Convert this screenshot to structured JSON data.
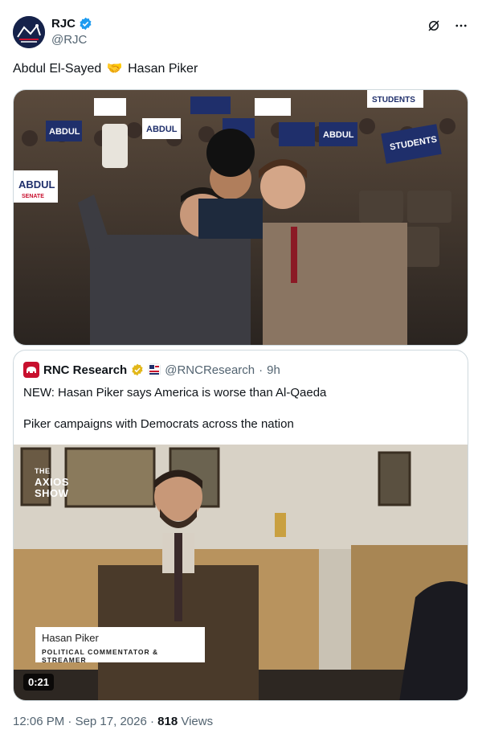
{
  "author": {
    "display_name": "RJC",
    "handle": "@RJC",
    "avatar_icon": "rjc-logo-icon",
    "verified_icon": "verified-badge-icon"
  },
  "actions": {
    "grok_icon": "grok-icon",
    "more_icon": "more-icon"
  },
  "tweet": {
    "text_before": "Abdul El-Sayed",
    "emoji": "🤝",
    "text_after": "Hasan Piker"
  },
  "media": {
    "signs": [
      "ABDUL",
      "STUDENTS",
      "ABDUL",
      "ABDUL",
      "ABDUL",
      "STUDENTS"
    ],
    "sign_sub": "SENATE",
    "sign_colors": {
      "navy": "#1f2f6b",
      "white": "#ffffff",
      "red": "#c8102e"
    }
  },
  "quote": {
    "display_name": "RNC Research",
    "handle": "@RNCResearch",
    "separator": "·",
    "time": "9h",
    "line1": "NEW: Hasan Piker says America is worse than Al-Qaeda",
    "line2": "Piker campaigns with Democrats across the nation",
    "video": {
      "show_logo_line1": "THE",
      "show_logo_line2": "AXIOS",
      "show_logo_line3": "SHOW",
      "lower_third_name": "Hasan Piker",
      "lower_third_title": "POLITICAL COMMENTATOR & STREAMER",
      "duration": "0:21"
    }
  },
  "meta": {
    "time": "12:06 PM",
    "separator": "·",
    "date": "Sep 17, 2026",
    "views_count": "818",
    "views_label": "Views"
  },
  "colors": {
    "text_primary": "#0f1419",
    "text_secondary": "#536471",
    "verified_blue": "#1d9bf0",
    "verified_gold": "#e2b719",
    "border": "#cfd9de"
  }
}
